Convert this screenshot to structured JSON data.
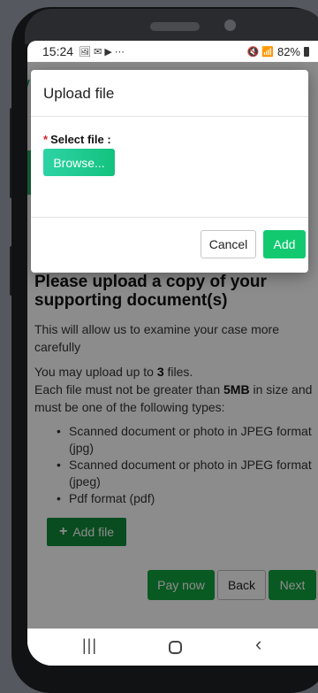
{
  "statusbar": {
    "time": "15:24",
    "left_icons": "🖼 ✉ ▶ ⋯",
    "right_icons": "🔇 📶",
    "battery": "82%"
  },
  "page": {
    "heading": "Please upload a copy of your supporting document(s)",
    "para1": "This will allow us to examine your case more carefully",
    "para2_prefix": "You may upload up to ",
    "max_files": "3",
    "para2_mid": " files.",
    "para2_line2_prefix": "Each file must not be greater than ",
    "max_size": "5MB",
    "para2_line2_suffix": " in size and must be one of the following types:",
    "file_types": [
      "Scanned document or photo in JPEG format (jpg)",
      "Scanned document or photo in JPEG format (jpeg)",
      "Pdf format (pdf)"
    ],
    "add_file_label": "Add file",
    "pay_now_label": "Pay now",
    "back_label": "Back",
    "next_label": "Next"
  },
  "dialog": {
    "title": "Upload file",
    "required_star": "*",
    "field_label": "Select file :",
    "browse_label": "Browse...",
    "cancel_label": "Cancel",
    "add_label": "Add"
  },
  "navbar": {
    "recents_glyph": "|||",
    "back_glyph": "‹"
  },
  "colors": {
    "primary_green": "#12a33f",
    "browse_green": "#13c27e",
    "required_red": "#d0262e"
  }
}
